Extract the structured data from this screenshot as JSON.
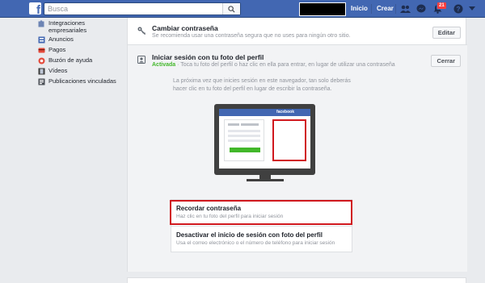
{
  "topbar": {
    "logo_letter": "f",
    "search_placeholder": "Busca",
    "nav": {
      "home": "Inicio",
      "create": "Crear"
    },
    "notifications_count": "21"
  },
  "sidebar": {
    "items": [
      {
        "label": "Integraciones empresariales",
        "icon": "puzzle-icon"
      },
      {
        "label": "Anuncios",
        "icon": "ads-icon"
      },
      {
        "label": "Pagos",
        "icon": "card-icon"
      },
      {
        "label": "Buzón de ayuda",
        "icon": "lifebuoy-icon"
      },
      {
        "label": "Vídeos",
        "icon": "film-icon"
      },
      {
        "label": "Publicaciones vinculadas",
        "icon": "linked-posts-icon"
      }
    ]
  },
  "settings": {
    "change_password": {
      "title": "Cambiar contraseña",
      "description": "Se recomienda usar una contraseña segura que no uses para ningún otro sitio.",
      "button": "Editar"
    },
    "profile_login": {
      "title": "Iniciar sesión con tu foto del perfil",
      "status": "Activada",
      "description": " · Toca tu foto del perfil o haz clic en ella para entrar, en lugar de utilizar una contraseña",
      "button": "Cerrar",
      "info": "La próxima vez que inicies sesión en este navegador, tan solo deberás hacer clic en tu foto del perfil en lugar de escribir la contraseña.",
      "illustration_brand": "facebook",
      "options": [
        {
          "title": "Recordar contraseña",
          "description": "Haz clic en tu foto del perfil para iniciar sesión"
        },
        {
          "title": "Desactivar el inicio de sesión con foto del perfil",
          "description": "Usa el correo electrónico o el número de teléfono para iniciar sesión"
        }
      ]
    }
  },
  "colors": {
    "brand": "#4267b2",
    "highlight": "#d0181e",
    "active_green": "#42b72a"
  }
}
